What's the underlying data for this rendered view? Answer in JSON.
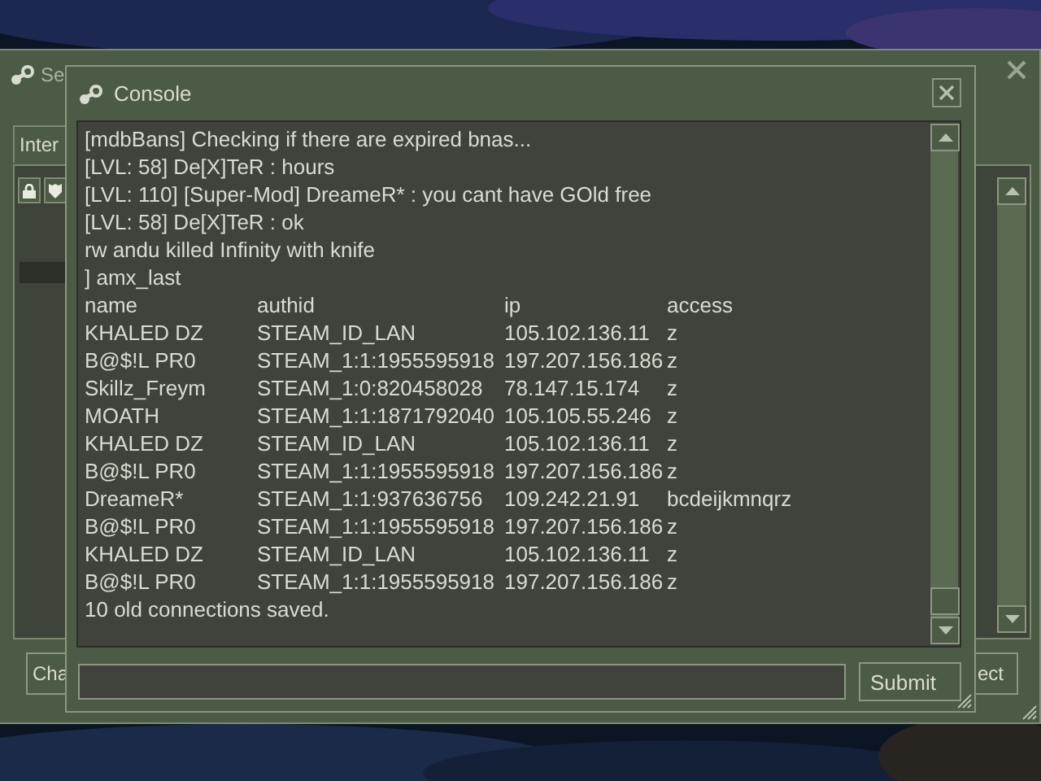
{
  "background_window": {
    "title": "Se",
    "tabs": [
      {
        "label": "Inter",
        "selected": true
      }
    ],
    "buttons": [
      "Cha",
      "ect"
    ]
  },
  "console": {
    "title": "Console",
    "lines": [
      "[mdbBans] Checking if there are expired bnas...",
      "[LVL: 58] De[X]TeR : hours",
      "[LVL: 110] [Super-Mod] DreameR* : you cant have GOld free",
      "[LVL: 58] De[X]TeR : ok",
      "rw andu killed Infinity with knife",
      "] amx_last"
    ],
    "table": {
      "columns": [
        "name",
        "authid",
        "ip",
        "access"
      ],
      "rows": [
        [
          "KHALED DZ",
          "STEAM_ID_LAN",
          "105.102.136.11",
          "z"
        ],
        [
          "B@$!L PR0",
          "STEAM_1:1:1955595918",
          "197.207.156.186",
          "z"
        ],
        [
          "Skillz_Freym",
          "STEAM_1:0:820458028",
          "78.147.15.174",
          "z"
        ],
        [
          "MOATH",
          "STEAM_1:1:1871792040",
          "105.105.55.246",
          "z"
        ],
        [
          "KHALED DZ",
          "STEAM_ID_LAN",
          "105.102.136.11",
          "z"
        ],
        [
          "B@$!L PR0",
          "STEAM_1:1:1955595918",
          "197.207.156.186",
          "z"
        ],
        [
          "DreameR*",
          "STEAM_1:1:937636756",
          "109.242.21.91",
          "bcdeijkmnqrz"
        ],
        [
          "B@$!L PR0",
          "STEAM_1:1:1955595918",
          "197.207.156.186",
          "z"
        ],
        [
          "KHALED DZ",
          "STEAM_ID_LAN",
          "105.102.136.11",
          "z"
        ],
        [
          "B@$!L PR0",
          "STEAM_1:1:1955595918",
          "197.207.156.186",
          "z"
        ]
      ]
    },
    "footer_line": "10 old connections saved.",
    "submit_button": "Submit"
  }
}
